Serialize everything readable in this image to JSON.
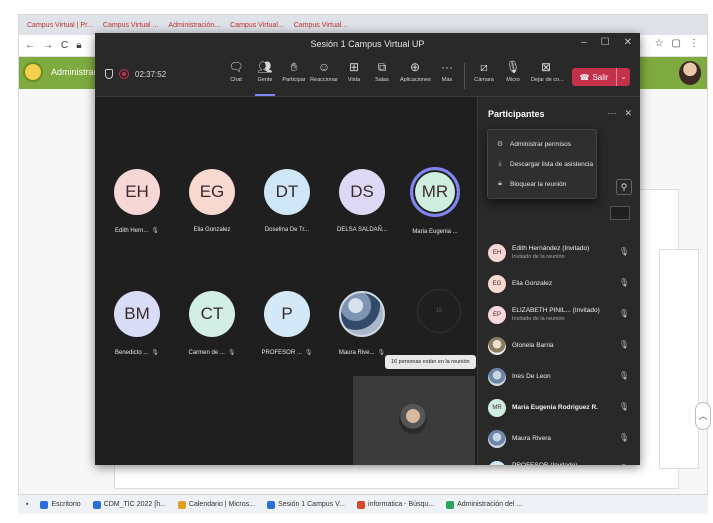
{
  "browser": {
    "tabs": [
      "Campus Virtual | Pr...",
      "Campus Virtual ...",
      "Administración...",
      "Campus Virtual...",
      "Campus Virtual..."
    ],
    "admin_link": "Administraci"
  },
  "window": {
    "title": "Sesión 1 Campus Virtual UP"
  },
  "toolbar": {
    "timer": "02:37:52",
    "buttons": [
      {
        "label": "Chat",
        "icon": "chat-icon"
      },
      {
        "label": "Gente",
        "icon": "people-icon"
      },
      {
        "label": "Participar",
        "icon": "hand-icon"
      },
      {
        "label": "Reaccionar",
        "icon": "smile-icon"
      },
      {
        "label": "Vista",
        "icon": "grid-icon"
      },
      {
        "label": "Salas",
        "icon": "rooms-icon"
      },
      {
        "label": "Aplicaciones",
        "icon": "plus-icon"
      },
      {
        "label": "Más",
        "icon": "more-icon"
      },
      {
        "label": "Cámara",
        "icon": "camera-off-icon"
      },
      {
        "label": "Micro",
        "icon": "mic-icon"
      },
      {
        "label": "Dejar de co...",
        "icon": "share-stop-icon"
      }
    ],
    "leave_label": "Salir"
  },
  "gallery": {
    "tiles": [
      {
        "initials": "EH",
        "name": "Edith Hern...",
        "color": "#f7d6d6"
      },
      {
        "initials": "EG",
        "name": "Elia Gonzalez",
        "color": "#f7d9cf"
      },
      {
        "initials": "DT",
        "name": "Doselina De Tr...",
        "color": "#cfe6f7"
      },
      {
        "initials": "DS",
        "name": "DELSA SALDAÑ...",
        "color": "#ddd9f4"
      },
      {
        "initials": "MR",
        "name": "Maria Eugenia ...",
        "color": "#cfeee0"
      },
      {
        "initials": "BM",
        "name": "Benedicto ...",
        "color": "#d9dcf7"
      },
      {
        "initials": "CT",
        "name": "Carmen de ...",
        "color": "#d3efe5"
      },
      {
        "initials": "P",
        "name": "PROFESOR ...",
        "color": "#d4e9f7"
      },
      {
        "initials": "",
        "name": "Maura Rive...",
        "color": "#cfd8e3"
      }
    ],
    "empty_label": "16",
    "tooltip": "16 personas están en la reunión"
  },
  "panel": {
    "title": "Participantes",
    "menu": [
      {
        "label": "Administrar permisos",
        "icon": "gear-icon"
      },
      {
        "label": "Descargar lista de asistencia",
        "icon": "download-icon"
      },
      {
        "label": "Bloquear la reunión",
        "icon": "lock-icon"
      }
    ],
    "participants": [
      {
        "initials": "EH",
        "name": "Edith Hernández (Invitado)",
        "sub": "Invitado de la reunión",
        "color": "#f7d6d6",
        "bold": false
      },
      {
        "initials": "EG",
        "name": "Elia Gonzalez",
        "sub": "",
        "color": "#f7d9cf",
        "bold": false
      },
      {
        "initials": "EP",
        "name": "ELIZABETH PINIL... (Invitado)",
        "sub": "Invitado de la reunión",
        "color": "#f7d6dc",
        "bold": false
      },
      {
        "initials": "",
        "name": "Gloriela Barria",
        "sub": "",
        "color": "gray",
        "bold": false
      },
      {
        "initials": "",
        "name": "Ines De Leon",
        "sub": "",
        "color": "photo",
        "bold": false
      },
      {
        "initials": "MR",
        "name": "Maria Eugenia Rodriguez R.",
        "sub": "",
        "color": "#cfeee0",
        "bold": true
      },
      {
        "initials": "",
        "name": "Maura Rivera",
        "sub": "",
        "color": "photo",
        "bold": false
      },
      {
        "initials": "P",
        "name": "PROFESOR (Invitado)",
        "sub": "Invitado de la reunión",
        "color": "#d4e9f7",
        "bold": false
      }
    ]
  },
  "taskbar": {
    "items": [
      "Escritorio",
      "CDM_TIC 2022 [h...",
      "Calendario | Micros...",
      "Sesión 1 Campus V...",
      "informatica - Búsqu...",
      "Administración del ..."
    ]
  }
}
